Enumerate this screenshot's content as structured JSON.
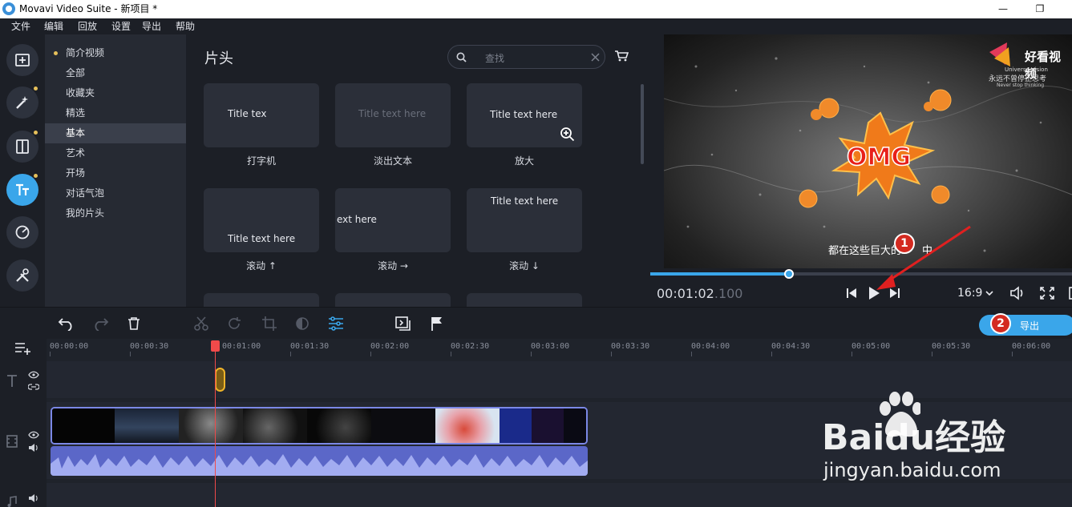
{
  "window": {
    "title": "Movavi Video Suite - 新项目 *",
    "minimize": "—",
    "restore": "❐"
  },
  "menu": [
    "文件",
    "编辑",
    "回放",
    "设置",
    "导出",
    "帮助"
  ],
  "sidebar_icons": [
    "add-media-icon",
    "magic-wand-icon",
    "transitions-icon",
    "titles-icon",
    "stickers-icon",
    "tools-icon"
  ],
  "categories": [
    {
      "label": "简介视频",
      "bullet": true
    },
    {
      "label": "全部"
    },
    {
      "label": "收藏夹"
    },
    {
      "label": "精选"
    },
    {
      "label": "基本",
      "selected": true
    },
    {
      "label": "艺术"
    },
    {
      "label": "开场"
    },
    {
      "label": "对话气泡"
    },
    {
      "label": "我的片头"
    }
  ],
  "titles_panel": {
    "heading": "片头",
    "search_placeholder": "查找",
    "tiles": [
      {
        "text": "Title tex",
        "label": "打字机"
      },
      {
        "text": "Title text here",
        "label": "淡出文本",
        "dim": true
      },
      {
        "text": "Title text here",
        "label": "放大",
        "zoom": true
      },
      {
        "text": "Title text here",
        "label": "滚动 ↑"
      },
      {
        "text": "ext here",
        "label": "滚动 →"
      },
      {
        "text": "Title text here",
        "label": "滚动 ↓"
      }
    ]
  },
  "preview": {
    "brand": "好看视频",
    "brand_sub1": "Universe Vision",
    "brand_sub2": "永远不曾停止思考",
    "brand_sub3": "Never stop thinking",
    "burst_text": "OMG",
    "subtitle": "都在这些巨大的",
    "subtitle_tail": "中",
    "timecode_main": "00:01:02",
    "timecode_ms": ".100",
    "progress": 0.33,
    "aspect_ratio": "16:9"
  },
  "toolbar": {
    "export_label": "导出"
  },
  "timeline": {
    "ruler": [
      "00:00:00",
      "00:00:30",
      "00:01:00",
      "00:01:30",
      "00:02:00",
      "00:02:30",
      "00:03:00",
      "00:03:30",
      "00:04:00",
      "00:04:30",
      "00:05:00",
      "00:05:30",
      "00:06:00"
    ]
  },
  "annotations": {
    "badge1": "1",
    "badge2": "2"
  },
  "watermark": {
    "brand": "Baidu经验",
    "url": "jingyan.baidu.com"
  },
  "colors": {
    "accent": "#3aa6ea",
    "background": "#1c1f26",
    "playhead": "#f04a4a",
    "clip_border": "#7b88e6",
    "audio": "#5b67c8"
  }
}
